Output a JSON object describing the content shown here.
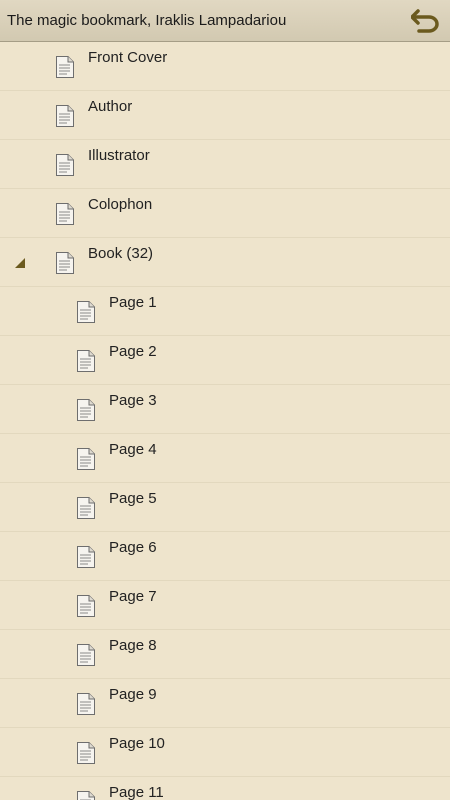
{
  "header": {
    "title": "The magic bookmark, Iraklis Lampadariou",
    "back_icon": "back-arrow-icon"
  },
  "colors": {
    "background": "#eee4cc",
    "header": "#d8cfb8",
    "accent": "#6b5a1e"
  },
  "toc": {
    "front_cover": "Front Cover",
    "author": "Author",
    "illustrator": "Illustrator",
    "colophon": "Colophon",
    "book": "Book (32)",
    "pages": [
      "Page 1",
      "Page 2",
      "Page 3",
      "Page 4",
      "Page 5",
      "Page 6",
      "Page 7",
      "Page 8",
      "Page 9",
      "Page 10",
      "Page 11"
    ]
  }
}
